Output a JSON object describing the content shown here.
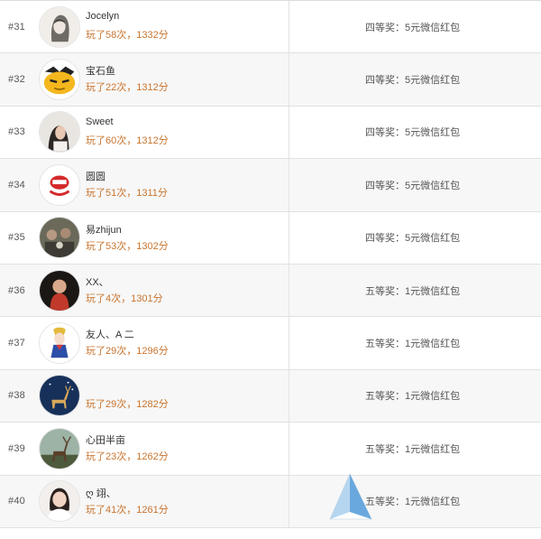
{
  "rows": [
    {
      "rank": "#31",
      "name": "Jocelyn",
      "score": "玩了58次，1332分",
      "prize": "四等奖：5元微信红包",
      "avatar_icon": "woman-sketch-avatar"
    },
    {
      "rank": "#32",
      "name": "宝石鱼",
      "score": "玩了22次，1312分",
      "prize": "四等奖：5元微信红包",
      "avatar_icon": "yellow-cartoon-avatar"
    },
    {
      "rank": "#33",
      "name": "Sweet",
      "score": "玩了60次，1312分",
      "prize": "四等奖：5元微信红包",
      "avatar_icon": "woman-photo-avatar"
    },
    {
      "rank": "#34",
      "name": "圆圆",
      "score": "玩了51次，1311分",
      "prize": "四等奖：5元微信红包",
      "avatar_icon": "red-logo-avatar"
    },
    {
      "rank": "#35",
      "name": "易zhijun",
      "score": "玩了53次，1302分",
      "prize": "四等奖：5元微信红包",
      "avatar_icon": "group-photo-avatar"
    },
    {
      "rank": "#36",
      "name": "XX、",
      "score": "玩了4次，1301分",
      "prize": "五等奖：1元微信红包",
      "avatar_icon": "child-photo-avatar"
    },
    {
      "rank": "#37",
      "name": "友人、A 二",
      "score": "玩了29次，1296分",
      "prize": "五等奖：1元微信红包",
      "avatar_icon": "anime-character-avatar"
    },
    {
      "rank": "#38",
      "name": "",
      "score": "玩了29次，1282分",
      "prize": "五等奖：1元微信红包",
      "avatar_icon": "deer-night-avatar"
    },
    {
      "rank": "#39",
      "name": "心田半亩",
      "score": "玩了23次，1262分",
      "prize": "五等奖：1元微信红包",
      "avatar_icon": "elk-landscape-avatar"
    },
    {
      "rank": "#40",
      "name": "ღ 翊、",
      "score": "玩了41次，1261分",
      "prize": "五等奖：1元微信红包",
      "avatar_icon": "woman-portrait-avatar"
    }
  ],
  "colors": {
    "score_text": "#c8742e",
    "row_shade": "#f7f7f7",
    "divider": "#e1e1e1",
    "watermark_blue": "#3d8fd6"
  },
  "watermark_icon": "blue-triangle-logo-icon"
}
